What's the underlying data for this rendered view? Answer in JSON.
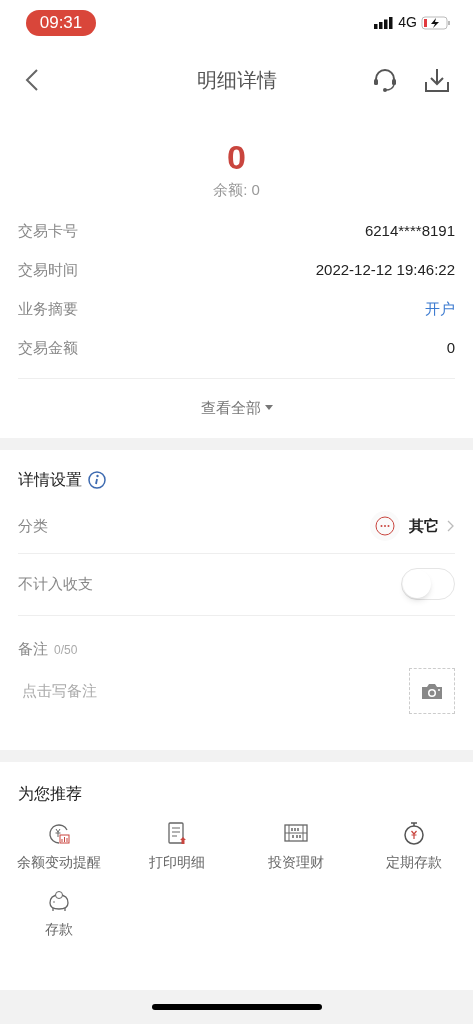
{
  "status_bar": {
    "time": "09:31",
    "network": "4G"
  },
  "nav": {
    "title": "明细详情"
  },
  "summary": {
    "amount": "0",
    "balance": "余额: 0"
  },
  "details": [
    {
      "label": "交易卡号",
      "value": "6214****8191",
      "kind": "plain"
    },
    {
      "label": "交易时间",
      "value": "2022-12-12 19:46:22",
      "kind": "plain"
    },
    {
      "label": "业务摘要",
      "value": "开户",
      "kind": "link"
    },
    {
      "label": "交易金额",
      "value": "0",
      "kind": "plain"
    }
  ],
  "view_all": "查看全部",
  "settings": {
    "title": "详情设置",
    "category": {
      "label": "分类",
      "value": "其它"
    },
    "exclude": {
      "label": "不计入收支",
      "on": false
    },
    "note": {
      "label": "备注",
      "count": "0/50",
      "placeholder": "点击写备注"
    }
  },
  "recommend": {
    "title": "为您推荐",
    "items": [
      {
        "label": "余额变动提醒",
        "kind": "alert"
      },
      {
        "label": "打印明细",
        "kind": "print"
      },
      {
        "label": "投资理财",
        "kind": "invest"
      },
      {
        "label": "定期存款",
        "kind": "fixed"
      },
      {
        "label": "存款",
        "kind": "deposit"
      }
    ]
  }
}
